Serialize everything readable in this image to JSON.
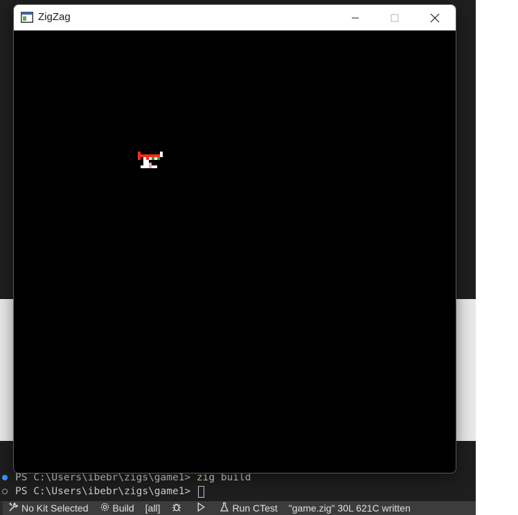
{
  "window": {
    "title": "ZigZag",
    "app_icon": "app-window-icon",
    "controls": [
      "minimize-icon",
      "maximize-icon",
      "close-icon"
    ],
    "canvas_color": "#000000"
  },
  "game": {
    "sprite": "player-sprite",
    "sprite_colors": [
      "#ff2a1a",
      "#ffffff",
      "#2aa82a",
      "#ff9ad6"
    ]
  },
  "terminal": {
    "lines": [
      {
        "prompt": "PS C:\\Users\\ibebr\\zigs\\game1> ",
        "cmd": "zig",
        "args": " build",
        "marker": "filled"
      },
      {
        "prompt": "PS C:\\Users\\ibebr\\zigs\\game1> ",
        "cmd": "",
        "args": "",
        "marker": "hollow"
      }
    ],
    "accent": "#3794ff"
  },
  "statusbar": {
    "kit": "No Kit Selected",
    "build": "Build",
    "target": "[all]",
    "run_ctest": "Run CTest",
    "message": "\"game.zig\" 30L 621C written"
  }
}
